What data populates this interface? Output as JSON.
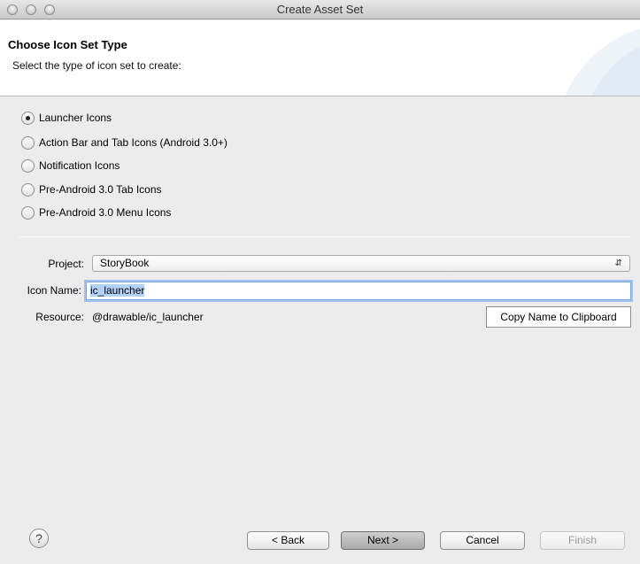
{
  "window": {
    "title": "Create Asset Set"
  },
  "header": {
    "title": "Choose Icon Set Type",
    "subtitle": "Select the type of icon set to create:"
  },
  "icon_types": [
    {
      "label": "Launcher Icons",
      "selected": true
    },
    {
      "label": "Action Bar and Tab Icons (Android 3.0+)",
      "selected": false
    },
    {
      "label": "Notification Icons",
      "selected": false
    },
    {
      "label": "Pre-Android 3.0 Tab Icons",
      "selected": false
    },
    {
      "label": "Pre-Android 3.0 Menu Icons",
      "selected": false
    }
  ],
  "form": {
    "project_label": "Project:",
    "project_value": "StoryBook",
    "icon_name_label": "Icon Name:",
    "icon_name_value": "ic_launcher",
    "resource_label": "Resource:",
    "resource_value": "@drawable/ic_launcher",
    "copy_button": "Copy Name to Clipboard"
  },
  "footer": {
    "help_icon": "?",
    "back": "< Back",
    "next": "Next >",
    "cancel": "Cancel",
    "finish": "Finish"
  }
}
